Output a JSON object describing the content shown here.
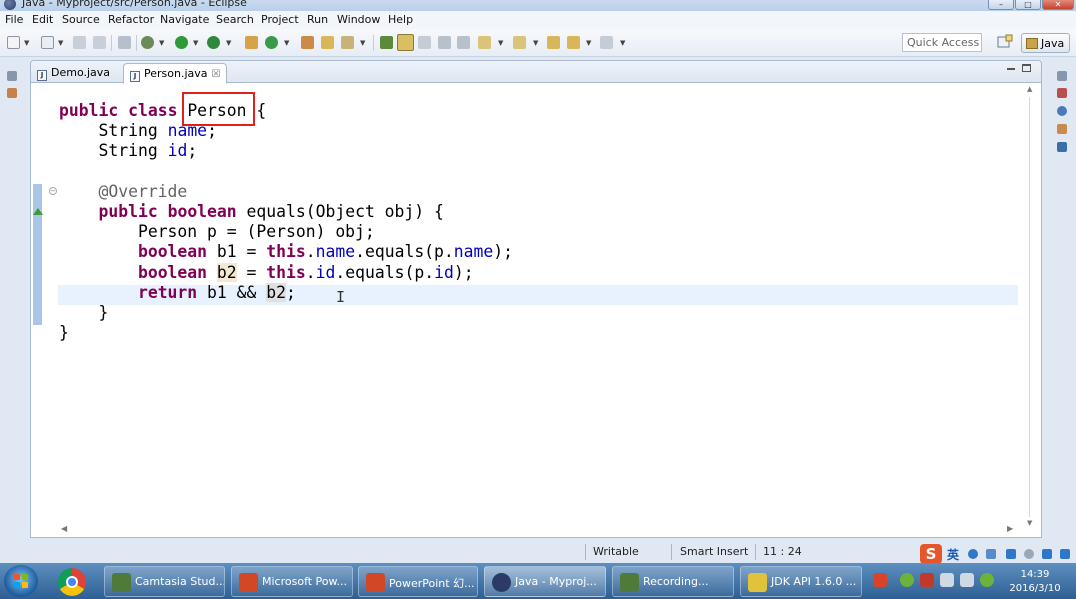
{
  "window": {
    "title": "Java - Myproject/src/Person.java - Eclipse",
    "min_label": "–",
    "max_label": "□",
    "close_label": "✕"
  },
  "menu": [
    "File",
    "Edit",
    "Source",
    "Refactor",
    "Navigate",
    "Search",
    "Project",
    "Run",
    "Window",
    "Help"
  ],
  "toolbar": {
    "quick_access_placeholder": "Quick Access",
    "perspective_label": "Java"
  },
  "editor": {
    "tabs": [
      {
        "label": "Demo.java",
        "icon": "J",
        "active": false
      },
      {
        "label": "Person.java",
        "icon": "J",
        "active": true,
        "close": "☒"
      }
    ],
    "code_lines": [
      [
        "public",
        "class",
        "Person",
        "{"
      ],
      [
        "String",
        "name",
        ";"
      ],
      [
        "String",
        "id",
        ";"
      ],
      [],
      [
        "@Override"
      ],
      [
        "public",
        "boolean",
        "equals(Object obj) {"
      ],
      [
        "Person p = (Person) obj;"
      ],
      [
        "boolean",
        "b1 =",
        "this",
        ".",
        "name",
        ".equals(p.",
        "name",
        ");"
      ],
      [
        "boolean",
        "b2",
        "=",
        "this",
        ".",
        "id",
        ".equals(p.",
        "id",
        ");"
      ],
      [
        "return",
        "b1 &&",
        "b2",
        ";"
      ],
      [
        "}"
      ],
      [
        "}"
      ]
    ],
    "highlighted_class": "Person",
    "cursor_glyph": "I"
  },
  "status": {
    "writable": "Writable",
    "insert_mode": "Smart Insert",
    "position": "11 : 24"
  },
  "ime": {
    "logo": "S",
    "mode": "英"
  },
  "taskbar": {
    "items": [
      {
        "label": "Camtasia Stud...",
        "icon_color": "#4f7a3a"
      },
      {
        "label": "Microsoft Pow...",
        "icon_color": "#d24726"
      },
      {
        "label": "PowerPoint 幻...",
        "icon_color": "#d24726"
      },
      {
        "label": "Java - Myproj...",
        "icon_color": "#2c3a66",
        "active": true
      },
      {
        "label": "Recording...",
        "icon_color": "#4f7a3a"
      },
      {
        "label": "JDK API 1.6.0 ...",
        "icon_color": "#e0c33a"
      }
    ],
    "clock_time": "14:39",
    "clock_date": "2016/3/10"
  },
  "colors": {
    "keyword": "#7f0055",
    "field": "#0000c0",
    "annotation": "#646464",
    "highlight_box": "#e0201a",
    "current_line": "#e8f2fe"
  }
}
